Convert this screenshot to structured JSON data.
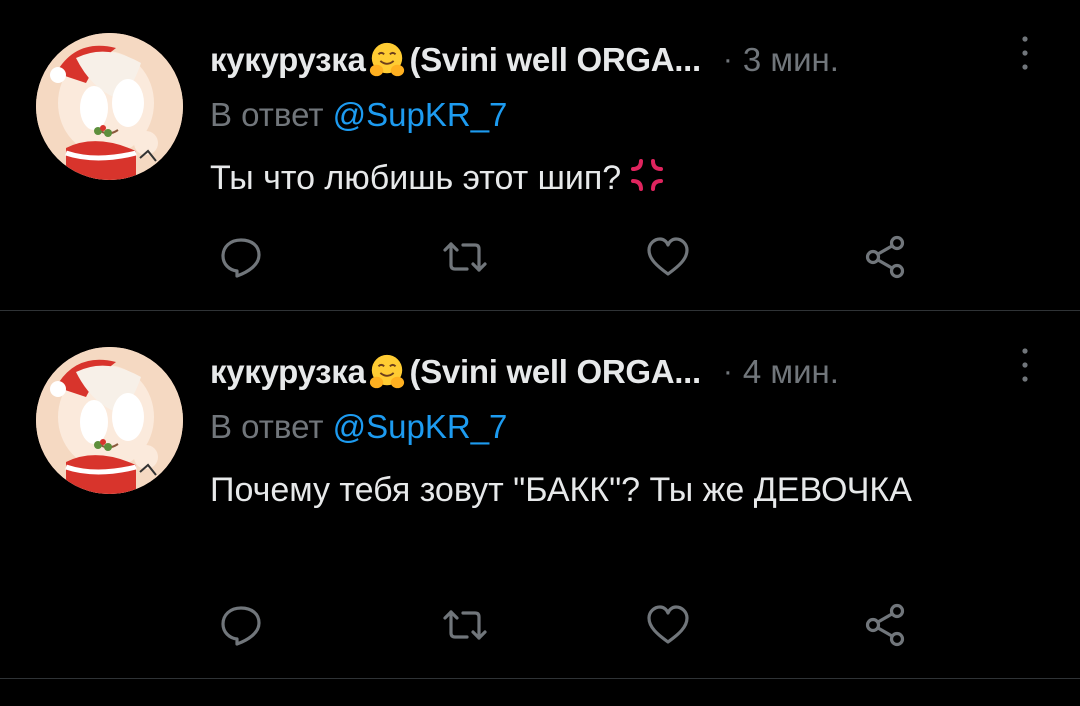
{
  "colors": {
    "background": "#000000",
    "text_primary": "#e7e9ea",
    "text_secondary": "#71767b",
    "mention": "#1d9bf0",
    "divider": "#2f3336"
  },
  "tweets": [
    {
      "display_name": "кукурузка",
      "display_name_emoji": "hugging-face-emoji",
      "display_name_rest": "(Svini well ORGA...",
      "separator": "·",
      "time": "3 мин.",
      "reply_prefix": "В ответ",
      "reply_mention": "@SupKR_7",
      "text": "Ты что любишь этот шип?",
      "text_emoji": "anger-symbol-emoji",
      "actions": [
        "reply-icon",
        "retweet-icon",
        "like-icon",
        "share-icon"
      ]
    },
    {
      "display_name": "кукурузка",
      "display_name_emoji": "hugging-face-emoji",
      "display_name_rest": "(Svini well ORGA...",
      "separator": "·",
      "time": "4 мин.",
      "reply_prefix": "В ответ",
      "reply_mention": "@SupKR_7",
      "text": "Почему тебя зовут \"БАКК\"? Ты же ДЕВОЧКА",
      "actions": [
        "reply-icon",
        "retweet-icon",
        "like-icon",
        "share-icon"
      ]
    }
  ]
}
